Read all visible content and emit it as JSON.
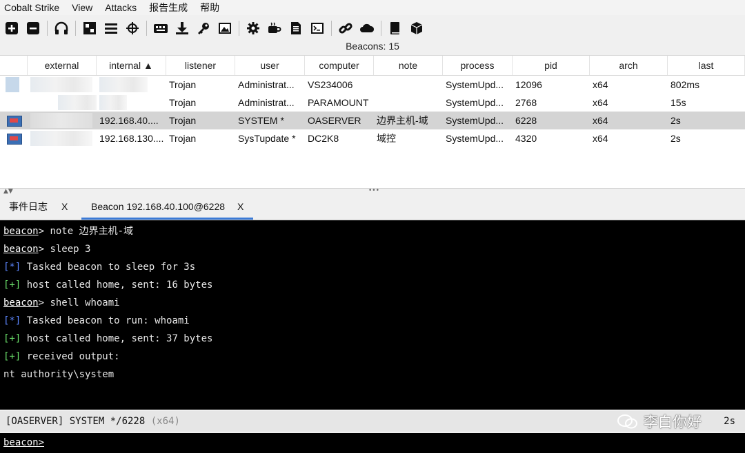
{
  "menu": [
    "Cobalt Strike",
    "View",
    "Attacks",
    "报告生成",
    "帮助"
  ],
  "toolbar_icons": [
    "plus-icon",
    "minus-icon",
    "headphones-icon",
    "target-grid-icon",
    "list-icon",
    "crosshair-icon",
    "keyboard-icon",
    "download-icon",
    "key-icon",
    "image-icon",
    "gear-icon",
    "coffee-icon",
    "document-icon",
    "terminal-icon",
    "link-icon",
    "cloud-icon",
    "book-icon",
    "cube-icon"
  ],
  "beacons_label": "Beacons: 15",
  "table": {
    "columns": [
      "",
      "external",
      "internal ▲",
      "listener",
      "user",
      "computer",
      "note",
      "process",
      "pid",
      "arch",
      "last"
    ],
    "rows": [
      {
        "listener": "Trojan",
        "user": "Administrat...",
        "computer": "VS234006",
        "note": "",
        "process": "SystemUpd...",
        "pid": "12096",
        "arch": "x64",
        "last": "802ms",
        "internal": ""
      },
      {
        "listener": "Trojan",
        "user": "Administrat...",
        "computer": "PARAMOUNT",
        "note": "",
        "process": "SystemUpd...",
        "pid": "2768",
        "arch": "x64",
        "last": "15s",
        "internal": ""
      },
      {
        "listener": "Trojan",
        "user": "SYSTEM *",
        "computer": "OASERVER",
        "note": "边界主机-域",
        "process": "SystemUpd...",
        "pid": "6228",
        "arch": "x64",
        "last": "2s",
        "internal": "192.168.40...."
      },
      {
        "listener": "Trojan",
        "user": "SysTupdate *",
        "computer": "DC2K8",
        "note": "域控",
        "process": "SystemUpd...",
        "pid": "4320",
        "arch": "x64",
        "last": "2s",
        "internal": "192.168.130...."
      }
    ]
  },
  "tabs": [
    {
      "label": "事件日志",
      "close": "X"
    },
    {
      "label": "Beacon 192.168.40.100@6228",
      "close": "X"
    }
  ],
  "console": {
    "prompt": "beacon",
    "lines": [
      {
        "type": "cmd",
        "text": "note 边界主机-域"
      },
      {
        "type": "cmd",
        "text": "sleep 3"
      },
      {
        "type": "info",
        "tag": "[*]",
        "text": "Tasked beacon to sleep for 3s"
      },
      {
        "type": "ok",
        "tag": "[+]",
        "text": "host called home, sent: 16 bytes"
      },
      {
        "type": "cmd",
        "text": "shell whoami"
      },
      {
        "type": "info",
        "tag": "[*]",
        "text": "Tasked beacon to run: whoami"
      },
      {
        "type": "ok",
        "tag": "[+]",
        "text": "host called home, sent: 37 bytes"
      },
      {
        "type": "ok",
        "tag": "[+]",
        "text": "received output:"
      },
      {
        "type": "out",
        "text": "nt authority\\system"
      }
    ]
  },
  "statusbar": {
    "left": "[OASERVER] SYSTEM */6228",
    "arch": "(x64)",
    "right": "2s"
  },
  "watermark": "李白你好",
  "input_prompt": "beacon>"
}
